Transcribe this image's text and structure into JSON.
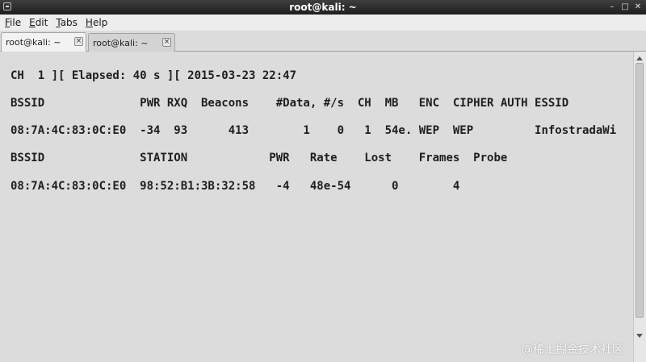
{
  "window": {
    "title": "root@kali: ~",
    "menu_icon": "window-menu-icon",
    "controls": [
      "minimize-icon",
      "maximize-icon",
      "close-icon"
    ]
  },
  "menubar": {
    "items": [
      {
        "mnemonic": "F",
        "rest": "ile"
      },
      {
        "mnemonic": "E",
        "rest": "dit"
      },
      {
        "mnemonic": "T",
        "rest": "abs"
      },
      {
        "mnemonic": "H",
        "rest": "elp"
      }
    ]
  },
  "tabs": [
    {
      "label": "root@kali: ~",
      "active": true,
      "close_icon": "close-icon"
    },
    {
      "label": "root@kali: ~",
      "active": false,
      "close_icon": "close-icon"
    }
  ],
  "terminal": {
    "lines": [
      "CH  1 ][ Elapsed: 40 s ][ 2015-03-23 22:47",
      "BSSID              PWR RXQ  Beacons    #Data, #/s  CH  MB   ENC  CIPHER AUTH ESSID",
      "08:7A:4C:83:0C:E0  -34  93      413        1    0   1  54e. WEP  WEP         InfostradaWi",
      "BSSID              STATION            PWR   Rate    Lost    Frames  Probe",
      "08:7A:4C:83:0C:E0  98:52:B1:3B:32:58   -4   48e-54      0        4"
    ]
  },
  "watermark": "@稀土掘金技术社区",
  "colors": {
    "titlebar": "#2f2f2f",
    "terminal_bg": "#dcdcdc",
    "terminal_fg": "#1e1e1e"
  }
}
